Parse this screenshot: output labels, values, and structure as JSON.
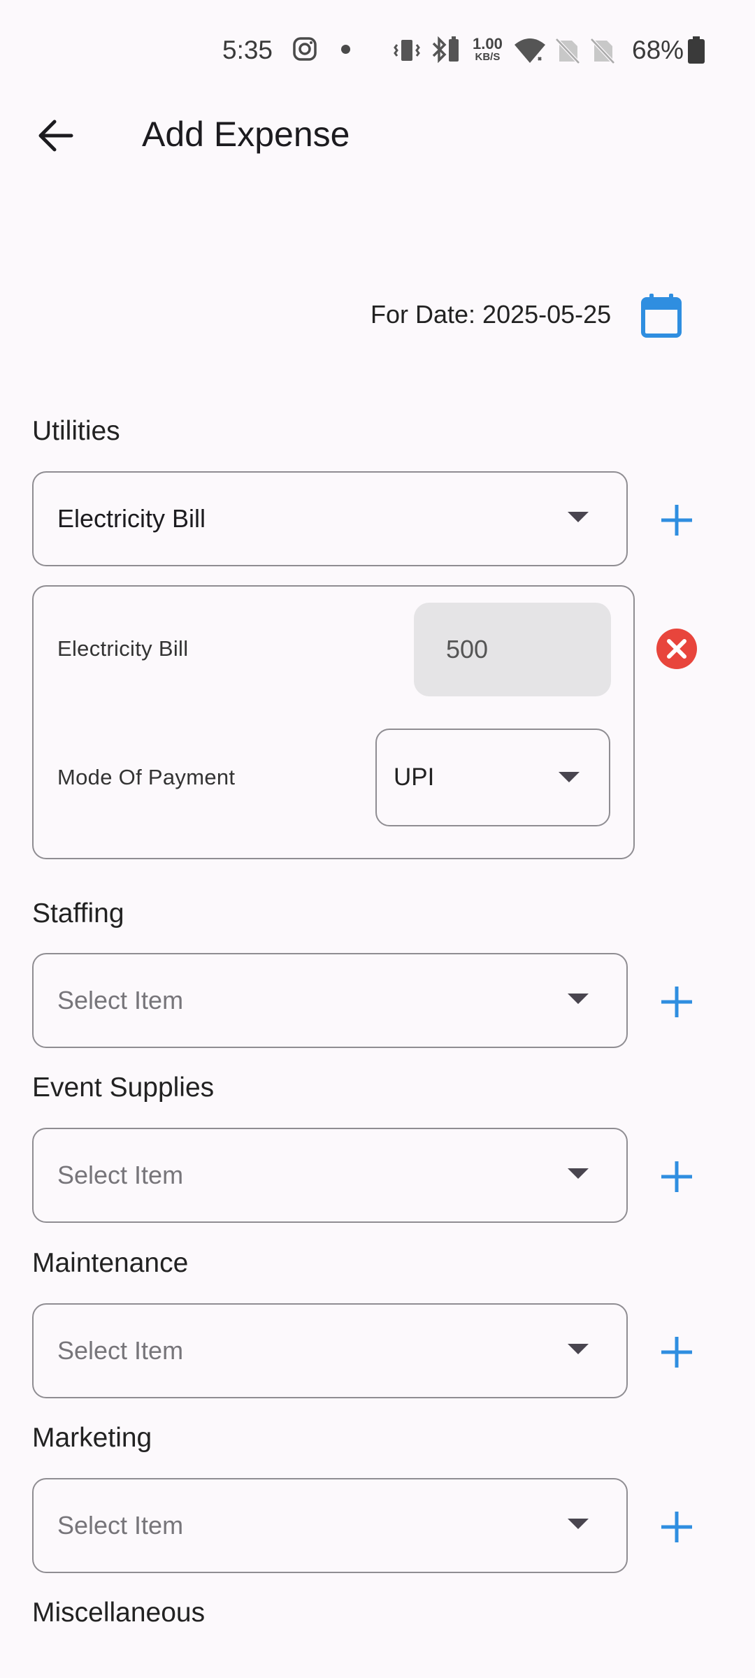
{
  "status_bar": {
    "time": "5:35",
    "net_speed_value": "1.00",
    "net_speed_unit": "KB/S",
    "battery": "68%"
  },
  "app_bar": {
    "title": "Add Expense"
  },
  "date": {
    "label": "For Date: 2025-05-25"
  },
  "sections": {
    "utilities": {
      "label": "Utilities",
      "selected": "Electricity Bill",
      "item": {
        "name": "Electricity Bill",
        "amount": "500",
        "payment_label": "Mode Of Payment",
        "payment_value": "UPI"
      }
    },
    "staffing": {
      "label": "Staffing",
      "placeholder": "Select Item"
    },
    "event_supplies": {
      "label": "Event Supplies",
      "placeholder": "Select Item"
    },
    "maintenance": {
      "label": "Maintenance",
      "placeholder": "Select Item"
    },
    "marketing": {
      "label": "Marketing",
      "placeholder": "Select Item"
    },
    "miscellaneous": {
      "label": "Miscellaneous"
    }
  },
  "colors": {
    "accent": "#2f8ee0",
    "remove": "#e8453c",
    "background": "#fcf9fc"
  }
}
